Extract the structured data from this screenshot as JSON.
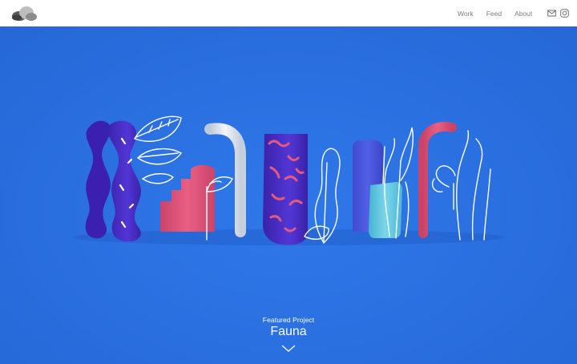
{
  "header": {
    "logo_icon": "rock-cluster-logo-icon",
    "nav": [
      {
        "label": "Work"
      },
      {
        "label": "Feed"
      },
      {
        "label": "About"
      }
    ],
    "social": [
      {
        "icon": "mail-icon"
      },
      {
        "icon": "instagram-icon"
      }
    ]
  },
  "hero": {
    "artwork": "fauna-3d-lettering",
    "featured_label": "Featured Project",
    "project_title": "Fauna",
    "scroll_icon": "chevron-down-icon"
  },
  "colors": {
    "background": "#2a6fe0",
    "header": "#ffffff",
    "nav_text": "#7d7d7d",
    "purple": "#4b2fc7",
    "pink": "#e45a7e",
    "cyan": "#5cc6e0",
    "white": "#ffffff"
  }
}
